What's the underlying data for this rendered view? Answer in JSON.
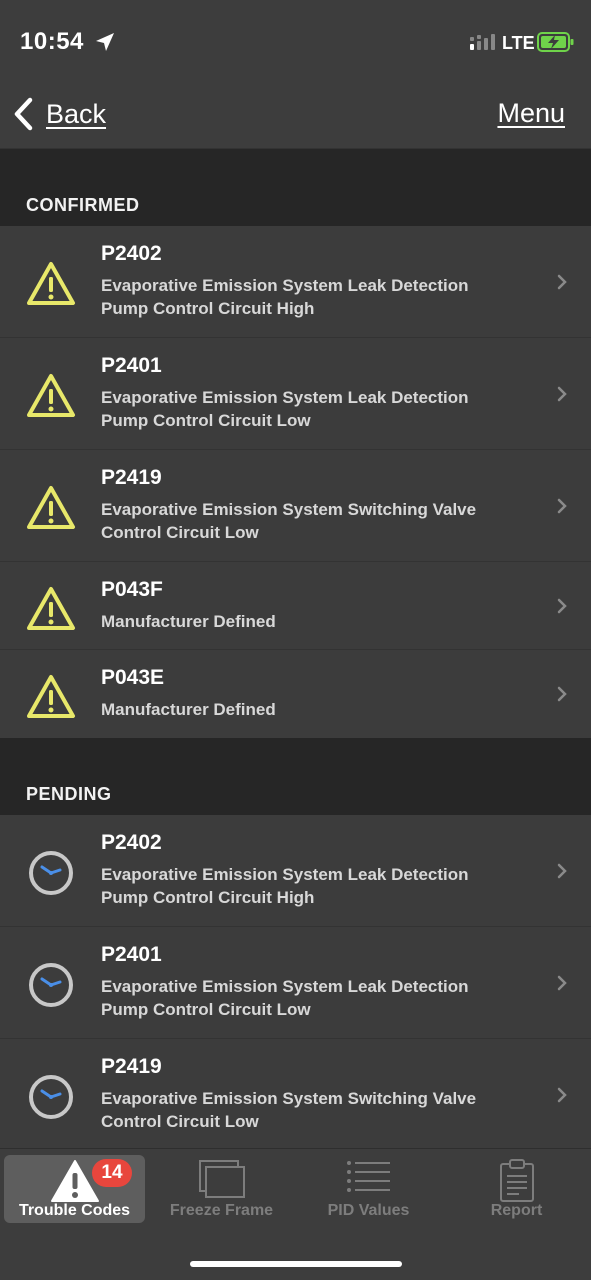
{
  "status_bar": {
    "time": "10:54",
    "network": "LTE"
  },
  "nav": {
    "back_label": "Back",
    "menu_label": "Menu"
  },
  "sections": {
    "confirmed": {
      "title": "CONFIRMED",
      "items": [
        {
          "code": "P2402",
          "description": "Evaporative Emission System Leak Detection\nPump Control Circuit High"
        },
        {
          "code": "P2401",
          "description": "Evaporative Emission System Leak Detection\nPump Control Circuit Low"
        },
        {
          "code": "P2419",
          "description": "Evaporative Emission System Switching Valve\nControl Circuit Low"
        },
        {
          "code": "P043F",
          "description": "Manufacturer Defined"
        },
        {
          "code": "P043E",
          "description": "Manufacturer Defined"
        }
      ]
    },
    "pending": {
      "title": "PENDING",
      "items": [
        {
          "code": "P2402",
          "description": "Evaporative Emission System Leak Detection\nPump Control Circuit High"
        },
        {
          "code": "P2401",
          "description": "Evaporative Emission System Leak Detection\nPump Control Circuit Low"
        },
        {
          "code": "P2419",
          "description": "Evaporative Emission System Switching Valve\nControl Circuit Low"
        }
      ]
    }
  },
  "tab_bar": {
    "tabs": [
      {
        "label": "Trouble Codes",
        "icon": "warning-icon",
        "active": true,
        "badge": "14"
      },
      {
        "label": "Freeze Frame",
        "icon": "freeze-frame-icon",
        "active": false
      },
      {
        "label": "PID Values",
        "icon": "list-icon",
        "active": false
      },
      {
        "label": "Report",
        "icon": "clipboard-icon",
        "active": false
      }
    ]
  },
  "colors": {
    "warning": "#e8e86a",
    "clock_ring": "#c8c8c8",
    "clock_hands": "#4a8fe8",
    "badge": "#e8463d",
    "background": "#3c3c3c",
    "section_bg": "#262626"
  }
}
